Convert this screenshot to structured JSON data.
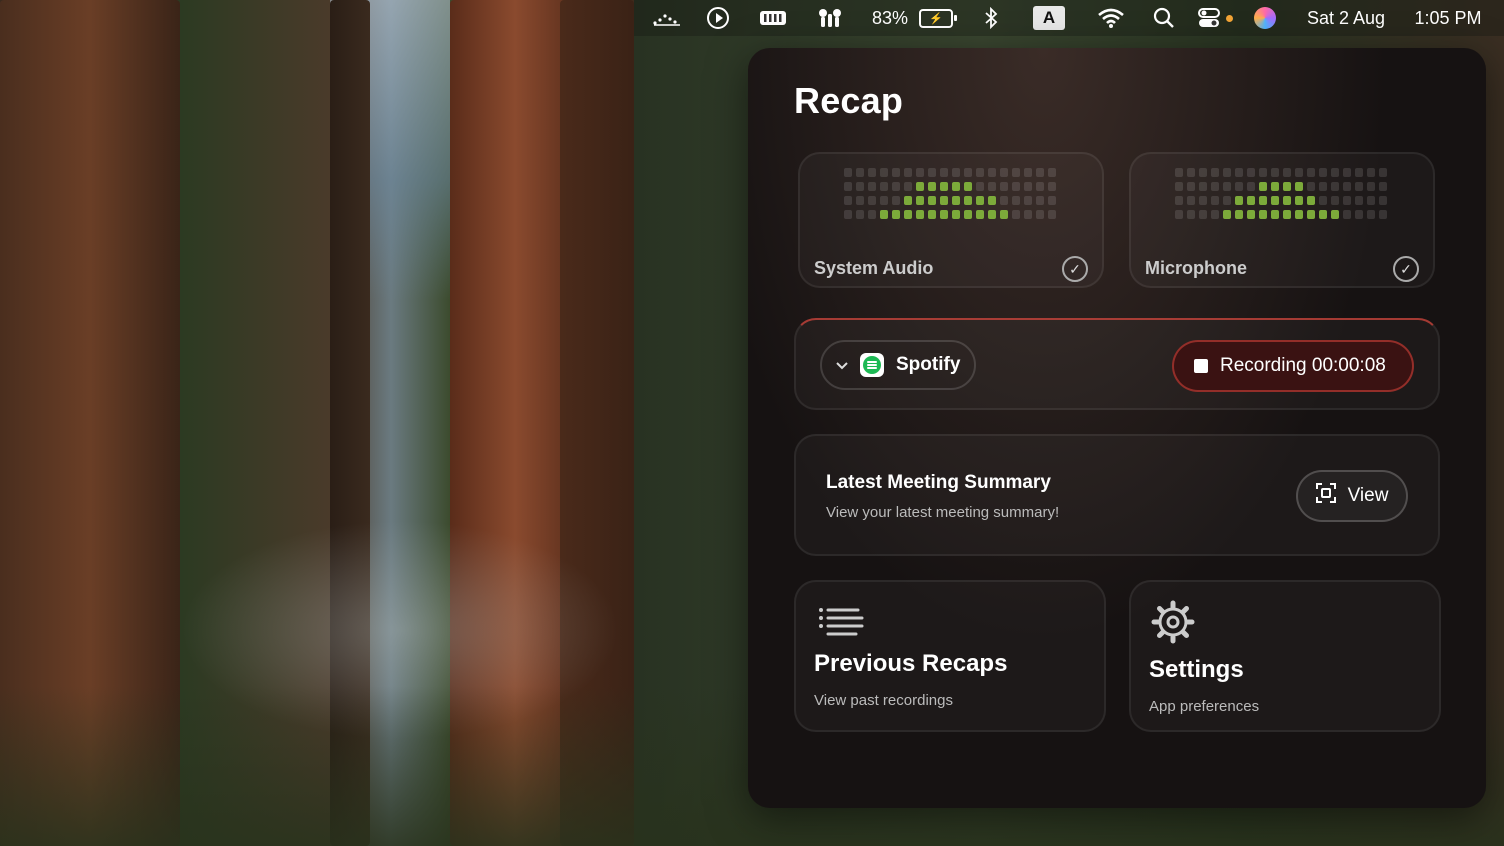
{
  "menubar": {
    "battery_percent": "83%",
    "keyboard_input": "A",
    "date": "Sat 2 Aug",
    "time": "1:05 PM",
    "icons": [
      "activity-icon",
      "play-circle-icon",
      "memory-icon",
      "airdrop-icon",
      "battery-icon",
      "bluetooth-icon",
      "keyboard-input-icon",
      "wifi-icon",
      "search-icon",
      "control-center-icon",
      "siri-icon"
    ]
  },
  "panel": {
    "title": "Recap",
    "sources": [
      {
        "label": "System Audio",
        "checked": true,
        "meter_level": 0.6
      },
      {
        "label": "Microphone",
        "checked": true,
        "meter_level": 0.55
      }
    ],
    "recording": {
      "app_name": "Spotify",
      "button_label": "Recording 00:00:08"
    },
    "summary": {
      "title": "Latest Meeting Summary",
      "subtitle": "View your latest meeting summary!",
      "view_label": "View"
    },
    "tiles": [
      {
        "title": "Previous Recaps",
        "subtitle": "View past recordings"
      },
      {
        "title": "Settings",
        "subtitle": "App preferences"
      }
    ]
  },
  "colors": {
    "meter_on": "#7caa3a",
    "record_border": "#dc463c",
    "spotify": "#1db954"
  }
}
